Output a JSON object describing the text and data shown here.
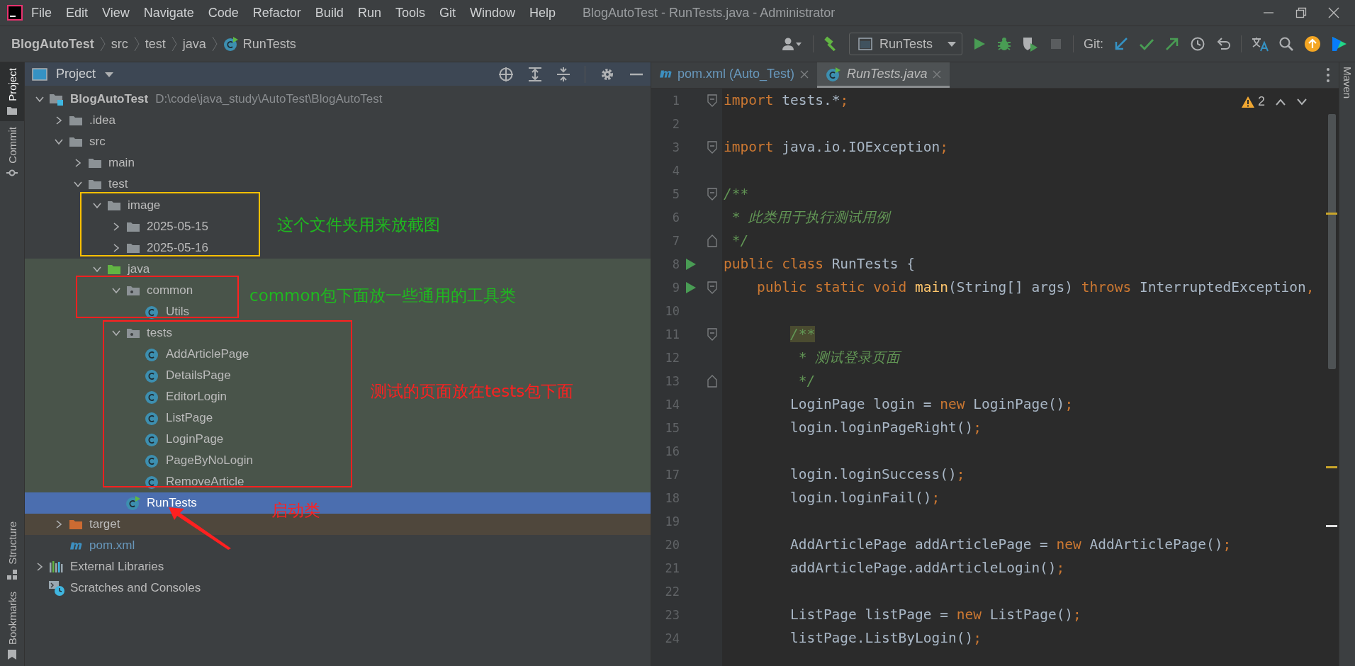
{
  "window": {
    "title": "BlogAutoTest - RunTests.java - Administrator"
  },
  "menu": [
    "File",
    "Edit",
    "View",
    "Navigate",
    "Code",
    "Refactor",
    "Build",
    "Run",
    "Tools",
    "Git",
    "Window",
    "Help"
  ],
  "breadcrumbs": [
    {
      "label": "BlogAutoTest",
      "kind": "project"
    },
    {
      "label": "src",
      "kind": "folder"
    },
    {
      "label": "test",
      "kind": "folder"
    },
    {
      "label": "java",
      "kind": "folder"
    },
    {
      "label": "RunTests",
      "kind": "run-class"
    }
  ],
  "toolbar": {
    "run_config": "RunTests",
    "git_label": "Git:",
    "stop": {
      "disabled": true
    }
  },
  "left_tabs": [
    {
      "label": "Project",
      "selected": true
    },
    {
      "label": "Commit",
      "selected": false
    },
    {
      "label": "Structure",
      "selected": false
    },
    {
      "label": "Bookmarks",
      "selected": false
    }
  ],
  "right_tabs": [
    {
      "label": "Maven",
      "selected": false
    }
  ],
  "project_panel": {
    "title": "Project"
  },
  "tree": [
    {
      "label": "BlogAutoTest",
      "path": "D:\\code\\java_study\\AutoTest\\BlogAutoTest",
      "kind": "module",
      "expanded": true,
      "selected": false,
      "children": [
        {
          "label": ".idea",
          "kind": "folder",
          "expanded": false,
          "selected": false
        },
        {
          "label": "src",
          "kind": "folder",
          "expanded": true,
          "selected": false,
          "children": [
            {
              "label": "main",
              "kind": "folder",
              "expanded": false,
              "selected": false
            },
            {
              "label": "test",
              "kind": "folder",
              "expanded": true,
              "selected": false,
              "children": [
                {
                  "label": "image",
                  "kind": "folder",
                  "expanded": true,
                  "selected": false,
                  "children": [
                    {
                      "label": "2025-05-15",
                      "kind": "folder",
                      "expanded": false,
                      "selected": false
                    },
                    {
                      "label": "2025-05-16",
                      "kind": "folder",
                      "expanded": false,
                      "selected": false
                    }
                  ]
                },
                {
                  "label": "java",
                  "kind": "test-root",
                  "expanded": true,
                  "selected": false,
                  "children": [
                    {
                      "label": "common",
                      "kind": "package",
                      "expanded": true,
                      "selected": false,
                      "children": [
                        {
                          "label": "Utils",
                          "kind": "class",
                          "selected": false
                        }
                      ]
                    },
                    {
                      "label": "tests",
                      "kind": "package",
                      "expanded": true,
                      "selected": false,
                      "children": [
                        {
                          "label": "AddArticlePage",
                          "kind": "class",
                          "selected": false
                        },
                        {
                          "label": "DetailsPage",
                          "kind": "class",
                          "selected": false
                        },
                        {
                          "label": "EditorLogin",
                          "kind": "class",
                          "selected": false
                        },
                        {
                          "label": "ListPage",
                          "kind": "class",
                          "selected": false
                        },
                        {
                          "label": "LoginPage",
                          "kind": "class",
                          "selected": false
                        },
                        {
                          "label": "PageByNoLogin",
                          "kind": "class",
                          "selected": false
                        },
                        {
                          "label": "RemoveArticle",
                          "kind": "class",
                          "selected": false
                        }
                      ]
                    },
                    {
                      "label": "RunTests",
                      "kind": "run-class",
                      "selected": true
                    }
                  ]
                }
              ]
            }
          ]
        },
        {
          "label": "target",
          "kind": "excluded-folder",
          "expanded": false,
          "selected": false
        },
        {
          "label": "pom.xml",
          "kind": "maven",
          "selected": false
        }
      ]
    },
    {
      "label": "External Libraries",
      "kind": "libraries",
      "expanded": false,
      "selected": false
    },
    {
      "label": "Scratches and Consoles",
      "kind": "scratches",
      "selected": false
    }
  ],
  "annotations": [
    {
      "kind": "box",
      "color": "#ffc000"
    },
    {
      "kind": "box",
      "color": "#ff2020"
    },
    {
      "kind": "box",
      "color": "#ff2020"
    },
    {
      "kind": "note",
      "text": "这个文件夹用来放截图",
      "color": "#1fb91f"
    },
    {
      "kind": "note",
      "text": "common包下面放一些通用的工具类",
      "color": "#1fb91f"
    },
    {
      "kind": "note",
      "text": "测试的页面放在tests包下面",
      "color": "#ff2020"
    },
    {
      "kind": "note",
      "text": "启动类",
      "color": "#ff2020"
    },
    {
      "kind": "arrow",
      "color": "#ff2020"
    }
  ],
  "editor_tabs": [
    {
      "label": "pom.xml (Auto_Test)",
      "kind": "maven",
      "selected": false,
      "preview": false
    },
    {
      "label": "RunTests.java",
      "kind": "run-class",
      "selected": true,
      "preview": true
    }
  ],
  "inspections": {
    "warnings": "2"
  },
  "code": [
    {
      "number": "1",
      "fold_open": true,
      "tokens": [
        {
          "text": "import",
          "kind": "keyword"
        },
        {
          "text": " tests.*",
          "kind": "plain"
        },
        {
          "text": ";",
          "kind": "keyword"
        }
      ]
    },
    {
      "number": "2"
    },
    {
      "number": "3",
      "fold_open": true,
      "tokens": [
        {
          "text": "import",
          "kind": "keyword"
        },
        {
          "text": " java.io.IOException",
          "kind": "plain"
        },
        {
          "text": ";",
          "kind": "keyword"
        }
      ]
    },
    {
      "number": "4"
    },
    {
      "number": "5",
      "fold_open": true,
      "tokens": [
        {
          "text": "/**",
          "kind": "comment"
        }
      ]
    },
    {
      "number": "6",
      "tokens": [
        {
          "text": " * 此类用于执行测试用例",
          "kind": "comment"
        }
      ]
    },
    {
      "number": "7",
      "fold_close": true,
      "tokens": [
        {
          "text": " */",
          "kind": "comment"
        }
      ]
    },
    {
      "number": "8",
      "run": true,
      "tokens": [
        {
          "text": "public class",
          "kind": "keyword"
        },
        {
          "text": " RunTests {",
          "kind": "plain"
        }
      ]
    },
    {
      "number": "9",
      "run": true,
      "fold_open": true,
      "tokens": [
        {
          "text": "    public static void ",
          "kind": "keyword"
        },
        {
          "text": "main",
          "kind": "method"
        },
        {
          "text": "(String[] args) ",
          "kind": "plain"
        },
        {
          "text": "throws",
          "kind": "keyword"
        },
        {
          "text": " InterruptedException",
          "kind": "plain"
        },
        {
          "text": ",",
          "kind": "keyword"
        }
      ]
    },
    {
      "number": "10"
    },
    {
      "number": "11",
      "fold_open": true,
      "tokens": [
        {
          "text": "        /**",
          "kind": "comment-match"
        }
      ]
    },
    {
      "number": "12",
      "tokens": [
        {
          "text": "         * 测试登录页面",
          "kind": "comment"
        }
      ]
    },
    {
      "number": "13",
      "fold_close": true,
      "tokens": [
        {
          "text": "         */",
          "kind": "comment"
        }
      ]
    },
    {
      "number": "14",
      "tokens": [
        {
          "text": "        LoginPage login = ",
          "kind": "plain"
        },
        {
          "text": "new",
          "kind": "keyword"
        },
        {
          "text": " LoginPage()",
          "kind": "plain"
        },
        {
          "text": ";",
          "kind": "keyword"
        }
      ]
    },
    {
      "number": "15",
      "tokens": [
        {
          "text": "        login.loginPageRight()",
          "kind": "plain"
        },
        {
          "text": ";",
          "kind": "keyword"
        }
      ]
    },
    {
      "number": "16"
    },
    {
      "number": "17",
      "tokens": [
        {
          "text": "        login.loginSuccess()",
          "kind": "plain"
        },
        {
          "text": ";",
          "kind": "keyword"
        }
      ]
    },
    {
      "number": "18",
      "tokens": [
        {
          "text": "        login.loginFail()",
          "kind": "plain"
        },
        {
          "text": ";",
          "kind": "keyword"
        }
      ]
    },
    {
      "number": "19"
    },
    {
      "number": "20",
      "tokens": [
        {
          "text": "        AddArticlePage addArticlePage = ",
          "kind": "plain"
        },
        {
          "text": "new",
          "kind": "keyword"
        },
        {
          "text": " AddArticlePage()",
          "kind": "plain"
        },
        {
          "text": ";",
          "kind": "keyword"
        }
      ]
    },
    {
      "number": "21",
      "tokens": [
        {
          "text": "        addArticlePage.addArticleLogin()",
          "kind": "plain"
        },
        {
          "text": ";",
          "kind": "keyword"
        }
      ]
    },
    {
      "number": "22"
    },
    {
      "number": "23",
      "tokens": [
        {
          "text": "        ListPage listPage = ",
          "kind": "plain"
        },
        {
          "text": "new",
          "kind": "keyword"
        },
        {
          "text": " ListPage()",
          "kind": "plain"
        },
        {
          "text": ";",
          "kind": "keyword"
        }
      ]
    },
    {
      "number": "24",
      "tokens": [
        {
          "text": "        listPage.ListByLogin()",
          "kind": "plain"
        },
        {
          "text": ";",
          "kind": "keyword"
        }
      ]
    }
  ]
}
